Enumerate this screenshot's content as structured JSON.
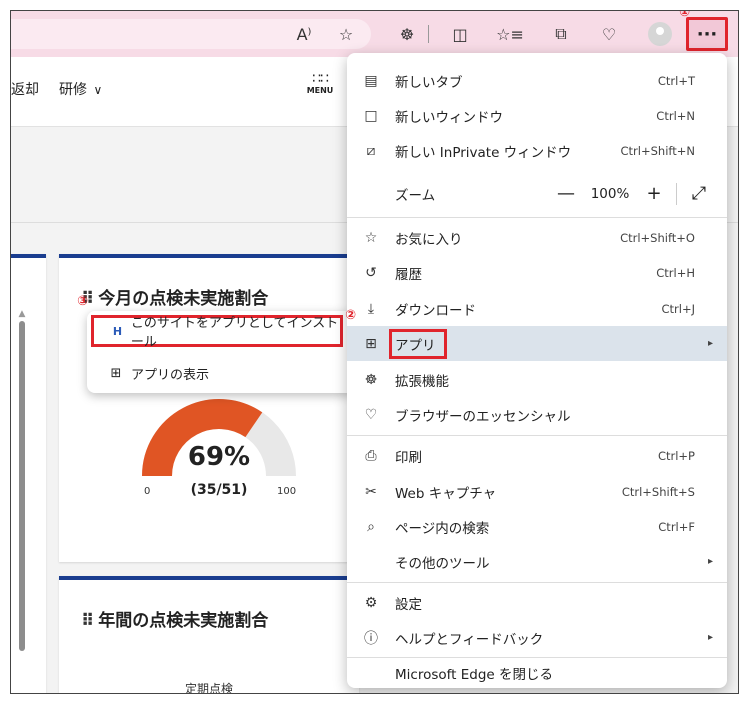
{
  "toolbar": {
    "read_aloud_icon": "A⁾",
    "favorite_star_icon": "☆",
    "extensions_icon": "☸",
    "split_screen_icon": "◫",
    "favorites_icon": "☆≡",
    "collections_icon": "⧉",
    "browser_essentials_icon": "♡",
    "more_label": "···"
  },
  "page": {
    "nav_return": "返却",
    "nav_training": "研修",
    "nav_training_chevron": "∨",
    "menu_label": "MENU",
    "menu_dots": "∷∷"
  },
  "card1": {
    "title": "今月の点検未実施割合",
    "gauge_value": 0.69,
    "gauge_pct": "69%",
    "gauge_frac": "(35/51)",
    "gauge_min": "0",
    "gauge_max": "100",
    "gauge_color": "#e05524",
    "gauge_rest_color": "#e8e8e8"
  },
  "card2": {
    "title": "年間の点検未実施割合",
    "subtitle": "定期点検"
  },
  "flyout": {
    "install_label": "このサイトをアプリとしてインストール",
    "install_icon": "H",
    "view_label": "アプリの表示",
    "view_icon": "⊞"
  },
  "menu": {
    "items": [
      {
        "label": "新しいタブ",
        "shortcut": "Ctrl+T",
        "icon": "▤"
      },
      {
        "label": "新しいウィンドウ",
        "shortcut": "Ctrl+N",
        "icon": "□"
      },
      {
        "label": "新しい InPrivate ウィンドウ",
        "shortcut": "Ctrl+Shift+N",
        "icon": "⧄"
      },
      {
        "label": "ズーム",
        "icon": ""
      },
      {
        "label": "お気に入り",
        "shortcut": "Ctrl+Shift+O",
        "icon": "☆"
      },
      {
        "label": "履歴",
        "shortcut": "Ctrl+H",
        "icon": "↺"
      },
      {
        "label": "ダウンロード",
        "shortcut": "Ctrl+J",
        "icon": "⤓"
      },
      {
        "label": "アプリ",
        "icon": "⊞",
        "arrow": "▸"
      },
      {
        "label": "拡張機能",
        "icon": "☸"
      },
      {
        "label": "ブラウザーのエッセンシャル",
        "icon": "♡"
      },
      {
        "label": "印刷",
        "shortcut": "Ctrl+P",
        "icon": "⎙"
      },
      {
        "label": "Web キャプチャ",
        "shortcut": "Ctrl+Shift+S",
        "icon": "✂"
      },
      {
        "label": "ページ内の検索",
        "shortcut": "Ctrl+F",
        "icon": "⌕"
      },
      {
        "label": "その他のツール",
        "icon": "",
        "arrow": "▸"
      },
      {
        "label": "設定",
        "icon": "⚙"
      },
      {
        "label": "ヘルプとフィードバック",
        "icon": "ⓘ",
        "arrow": "▸"
      },
      {
        "label": "Microsoft Edge を閉じる",
        "icon": ""
      }
    ],
    "zoom_value": "100%",
    "zoom_minus": "—",
    "zoom_plus": "+",
    "zoom_fullscreen_icon": "⤢"
  },
  "badges": {
    "step1": "①",
    "step2": "②",
    "step3": "③"
  },
  "colors": {
    "highlight_red": "#e0242c",
    "card_accent": "#1a3d8f",
    "toolbar_bg": "#f7dbe6"
  }
}
